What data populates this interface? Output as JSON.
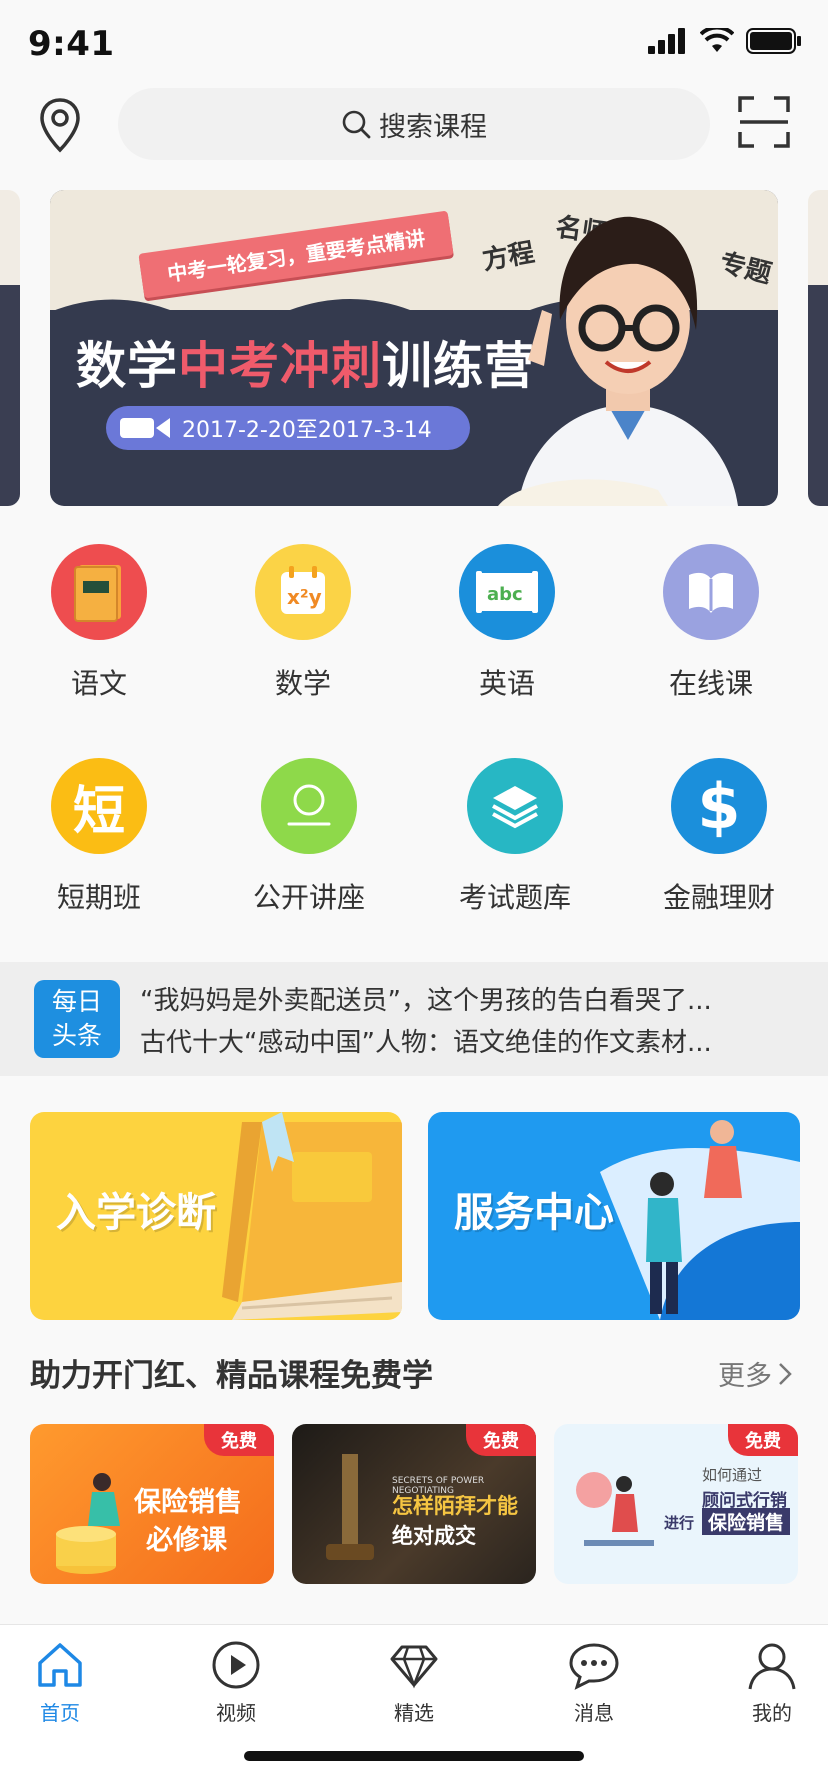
{
  "status_bar": {
    "time": "9:41"
  },
  "search": {
    "placeholder": "搜索课程"
  },
  "banner": {
    "ribbon": "中考一轮复习，重要考点精讲",
    "tags": [
      "方程",
      "名师",
      "专题"
    ],
    "title_part1": "数学",
    "title_highlight": "中考冲刺",
    "title_part2": "训练营",
    "date_range": "2017-2-20至2017-3-14"
  },
  "categories": [
    {
      "label": "语文",
      "icon": "chinese-book-icon",
      "color": "#ee4d4f"
    },
    {
      "label": "数学",
      "icon": "math-calendar-icon",
      "color": "#fbd346"
    },
    {
      "label": "英语",
      "icon": "abc-board-icon",
      "color": "#1b8fdb"
    },
    {
      "label": "在线课",
      "icon": "open-book-icon",
      "color": "#9aa2e0"
    },
    {
      "label": "短期班",
      "icon": "short-term-icon",
      "glyph": "短",
      "color": "#fbbd14"
    },
    {
      "label": "公开讲座",
      "icon": "lecture-person-icon",
      "color": "#8ed94a"
    },
    {
      "label": "考试题库",
      "icon": "layers-icon",
      "color": "#27b7c4"
    },
    {
      "label": "金融理财",
      "icon": "dollar-icon",
      "color": "#1b8fdb"
    }
  ],
  "news": {
    "badge_line1": "每日",
    "badge_line2": "头条",
    "items": [
      "“我妈妈是外卖配送员”，这个男孩的告白看哭了...",
      "古代十大“感动中国”人物：语文绝佳的作文素材..."
    ]
  },
  "features": [
    {
      "label": "入学诊断",
      "color": "#fdd33f"
    },
    {
      "label": "服务中心",
      "color": "#1f9af0"
    }
  ],
  "section": {
    "title": "助力开门红、精品课程免费学",
    "more": "更多"
  },
  "courses": [
    {
      "badge": "免费",
      "line1": "保险销售",
      "line2": "必修课"
    },
    {
      "badge": "免费",
      "small": "SECRETS OF POWER NEGOTIATING",
      "line1": "怎样陌拜才能",
      "line2": "绝对成交"
    },
    {
      "badge": "免费",
      "small": "如何通过",
      "line1": "顾问式行销",
      "prefix": "进行",
      "line2": "保险销售"
    }
  ],
  "tabbar": {
    "tabs": [
      {
        "label": "首页",
        "icon": "home-icon",
        "active": true
      },
      {
        "label": "视频",
        "icon": "play-icon"
      },
      {
        "label": "精选",
        "icon": "diamond-icon"
      },
      {
        "label": "消息",
        "icon": "chat-icon"
      },
      {
        "label": "我的",
        "icon": "user-icon"
      }
    ],
    "active_color": "#1e88e5"
  }
}
